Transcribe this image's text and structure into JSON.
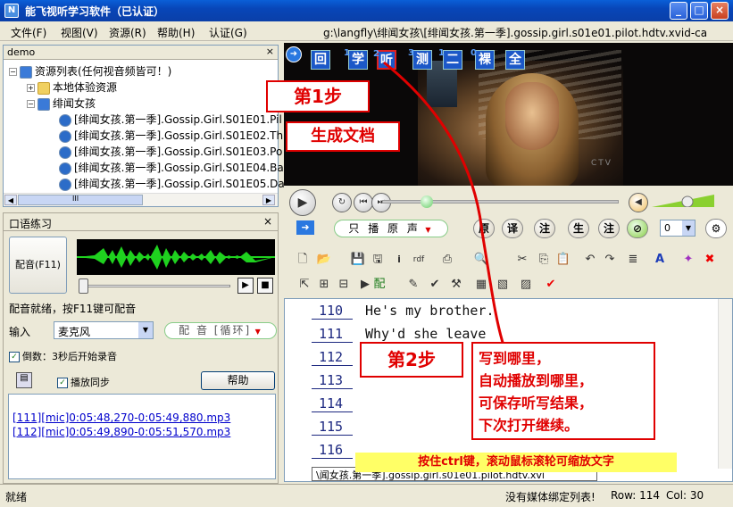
{
  "window": {
    "title": "能飞视听学习软件（已认证）"
  },
  "menu": [
    "文件(F)",
    "视图(V)",
    "资源(R)",
    "帮助(H)",
    "认证(G)"
  ],
  "path": "g:\\langfly\\绯闻女孩\\[绯闻女孩.第一季].gossip.girl.s01e01.pilot.hdtv.xvid-ca",
  "tree": {
    "header": "demo",
    "close": "×",
    "root": "资源列表(任何视音频皆可！)",
    "local": "本地体验资源",
    "series": "绯闻女孩",
    "files": [
      "[绯闻女孩.第一季].Gossip.Girl.S01E01.Pil",
      "[绯闻女孩.第一季].Gossip.Girl.S01E02.Th",
      "[绯闻女孩.第一季].Gossip.Girl.S01E03.Po",
      "[绯闻女孩.第一季].Gossip.Girl.S01E04.Ba",
      "[绯闻女孩.第一季].Gossip.Girl.S01E05.Da"
    ],
    "scroll_mark": "III"
  },
  "oral": {
    "title": "口语练习",
    "close": "×",
    "dub_button": "配音(F11)",
    "ready_text": "配音就绪，按F11键可配音",
    "input_label": "输入",
    "mic": "麦克风",
    "loop_button": "配 音 [循环]",
    "countdown": "倒数：3秒后开始录音",
    "sync_play": "播放同步",
    "help": "帮助",
    "files": [
      "[111][mic]0:05:48,270-0:05:49,880.mp3",
      "[112][mic]0:05:49,890-0:05:51,570.mp3"
    ]
  },
  "video": {
    "buttons": [
      {
        "label": "回",
        "num": ""
      },
      {
        "label": "学",
        "num": "1"
      },
      {
        "label": "听",
        "num": "2"
      },
      {
        "label": "测",
        "num": "3"
      },
      {
        "label": "二",
        "num": "1"
      },
      {
        "label": "裸",
        "num": "0"
      },
      {
        "label": "全",
        "num": ""
      }
    ],
    "watermark": "CTV"
  },
  "player": {
    "play_mode": "只 播 原 声",
    "mode_buttons": [
      "原",
      "译",
      "注",
      "生",
      "注"
    ],
    "speed": "0"
  },
  "toolbar2": {
    "pei": "配"
  },
  "editor": {
    "lines": [
      {
        "num": "110",
        "text": "He's my brother."
      },
      {
        "num": "111",
        "text": "Why'd she leave"
      },
      {
        "num": "112",
        "text": ""
      },
      {
        "num": "113",
        "text": ""
      },
      {
        "num": "114",
        "text": ""
      },
      {
        "num": "115",
        "text": ""
      },
      {
        "num": "116",
        "text": ""
      }
    ],
    "tab": "\\闻女孩.第一季].gossip.girl.s01e01.pilot.hdtv.xvi"
  },
  "status": {
    "left": "就绪",
    "media": "没有媒体绑定列表!",
    "row": "Row: 114",
    "col": "Col: 30"
  },
  "annotations": {
    "step1": "第1步",
    "gen_doc": "生成文档",
    "step2": "第2步",
    "note": [
      "写到哪里，",
      "自动播放到哪里，",
      "可保存听写结果，",
      "下次打开继续。"
    ],
    "hint": "按住ctrl键，滚动鼠标滚轮可缩放文字"
  }
}
